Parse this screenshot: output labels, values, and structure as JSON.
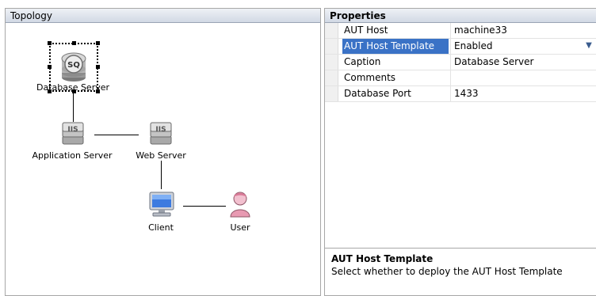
{
  "topology": {
    "title": "Topology",
    "nodes": {
      "database_server": {
        "label": "Database Server",
        "icon": "database-icon"
      },
      "application_server": {
        "label": "Application Server",
        "icon": "iis-server-icon"
      },
      "web_server": {
        "label": "Web Server",
        "icon": "iis-server-icon"
      },
      "client": {
        "label": "Client",
        "icon": "monitor-icon"
      },
      "user": {
        "label": "User",
        "icon": "user-icon"
      }
    }
  },
  "properties": {
    "title": "Properties",
    "rows": [
      {
        "name": "AUT Host",
        "value": "machine33"
      },
      {
        "name": "AUT Host Template",
        "value": "Enabled"
      },
      {
        "name": "Caption",
        "value": "Database Server"
      },
      {
        "name": "Comments",
        "value": ""
      },
      {
        "name": "Database Port",
        "value": "1433"
      }
    ],
    "selected_row": "AUT Host Template",
    "description": {
      "title": "AUT Host Template",
      "text": "Select whether to deploy the AUT Host Template"
    }
  },
  "colors": {
    "selection": "#3a72c6",
    "header_bg": "#d2d9e5"
  }
}
